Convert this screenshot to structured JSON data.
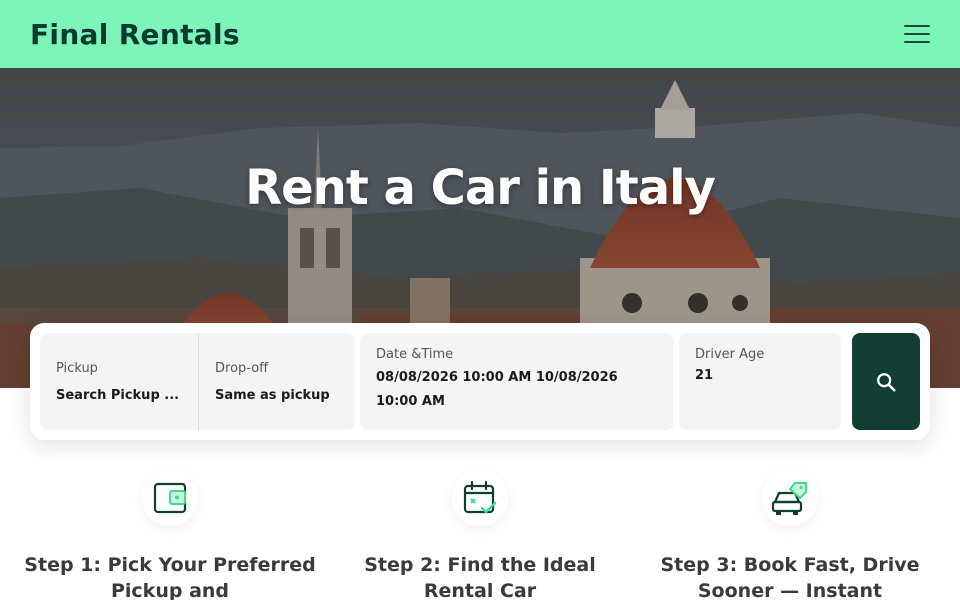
{
  "header": {
    "logo": "Final Rentals",
    "menu_icon": "hamburger-menu-icon",
    "background": "#7ef5b8"
  },
  "hero": {
    "title": "Rent a Car in Italy"
  },
  "search": {
    "pickup": {
      "label": "Pickup",
      "value": "Search Pickup ..."
    },
    "dropoff": {
      "label": "Drop-off",
      "value": "Same as pickup"
    },
    "datetime": {
      "label": "Date &Time",
      "value": "08/08/2026 10:00 AM 10/08/2026 10:00 AM"
    },
    "driver_age": {
      "label": "Driver Age",
      "value": "21"
    },
    "search_icon": "search-icon",
    "button_color": "#123d33"
  },
  "steps": [
    {
      "icon": "wallet-icon",
      "title": "Step 1: Pick Your Preferred Pickup and"
    },
    {
      "icon": "calendar-check-icon",
      "title": "Step 2: Find the Ideal Rental Car"
    },
    {
      "icon": "car-tag-icon",
      "title": "Step 3: Book Fast, Drive Sooner — Instant"
    }
  ]
}
